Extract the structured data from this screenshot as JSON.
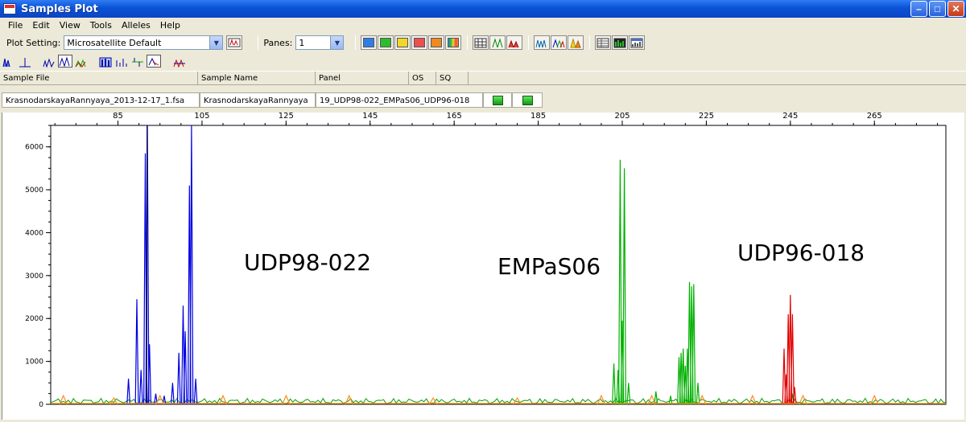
{
  "window": {
    "title": "Samples Plot",
    "buttons": [
      "minimize",
      "maximize",
      "close"
    ]
  },
  "menu": [
    "File",
    "Edit",
    "View",
    "Tools",
    "Alleles",
    "Help"
  ],
  "toolbar": {
    "plot_setting_label": "Plot Setting:",
    "plot_setting_value": "Microsatellite Default",
    "panes_label": "Panes:",
    "panes_value": "1",
    "color_swatches": [
      "#2f7ee8",
      "#2bbd2b",
      "#f2d62a",
      "#ec5050",
      "#f08a1e",
      "multicolor"
    ]
  },
  "table": {
    "headers": [
      "Sample File",
      "Sample Name",
      "Panel",
      "OS",
      "SQ"
    ],
    "row": {
      "sample_file": "KrasnodarskayaRannyaya_2013-12-17_1.fsa",
      "sample_name": "KrasnodarskayaRannyaya",
      "panel": "19_UDP98-022_EMPaS06_UDP96-018"
    }
  },
  "chart_data": {
    "type": "line",
    "x_ticks": [
      85,
      105,
      125,
      145,
      165,
      185,
      205,
      225,
      245,
      265
    ],
    "y_ticks": [
      0,
      1000,
      2000,
      3000,
      4000,
      5000,
      6000
    ],
    "xlim": [
      69,
      282
    ],
    "ylim": [
      0,
      6500
    ],
    "grid": false,
    "series": [
      {
        "color": "#0000e0",
        "peaks": [
          [
            87.5,
            600
          ],
          [
            89.5,
            2450
          ],
          [
            90.5,
            800
          ],
          [
            91.5,
            5850
          ],
          [
            92,
            6500
          ],
          [
            92.5,
            1400
          ],
          [
            94,
            250
          ],
          [
            96,
            200
          ],
          [
            98,
            500
          ],
          [
            99.5,
            1200
          ],
          [
            100.5,
            2300
          ],
          [
            101,
            1700
          ],
          [
            102,
            5100
          ],
          [
            102.5,
            6500
          ],
          [
            103.5,
            600
          ]
        ]
      },
      {
        "color": "#00b000",
        "peaks": [
          [
            203,
            950
          ],
          [
            204,
            800
          ],
          [
            204.5,
            5700
          ],
          [
            205,
            1950
          ],
          [
            205.5,
            5500
          ],
          [
            206.5,
            500
          ],
          [
            213,
            300
          ],
          [
            216.5,
            200
          ],
          [
            218.5,
            1100
          ],
          [
            219,
            1200
          ],
          [
            219.5,
            1300
          ],
          [
            220,
            900
          ],
          [
            220.5,
            1300
          ],
          [
            221,
            2850
          ],
          [
            221.5,
            2750
          ],
          [
            222,
            2800
          ],
          [
            223,
            500
          ],
          [
            245.5,
            250
          ]
        ]
      },
      {
        "color": "#e00000",
        "peaks": [
          [
            243.5,
            1300
          ],
          [
            244,
            700
          ],
          [
            244.5,
            2100
          ],
          [
            245,
            2550
          ],
          [
            245.5,
            2100
          ],
          [
            246,
            400
          ]
        ]
      },
      {
        "color": "#ff8c1a",
        "peaks": [
          [
            72,
            200
          ],
          [
            84,
            150
          ],
          [
            95,
            200
          ],
          [
            110,
            200
          ],
          [
            125,
            200
          ],
          [
            140,
            200
          ],
          [
            160,
            150
          ],
          [
            180,
            150
          ],
          [
            200,
            200
          ],
          [
            212,
            200
          ],
          [
            224,
            200
          ],
          [
            236,
            200
          ],
          [
            248,
            200
          ],
          [
            265,
            200
          ]
        ]
      }
    ],
    "annotations": [
      "UDP98-022",
      "EMPaS06",
      "UDP96-018"
    ]
  }
}
